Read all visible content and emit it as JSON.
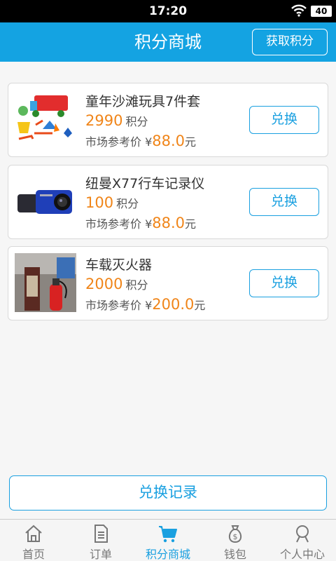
{
  "status_bar": {
    "time": "17:20",
    "battery": "40"
  },
  "header": {
    "title": "积分商城",
    "action_label": "获取积分"
  },
  "products": [
    {
      "name": "童年沙滩玩具7件套",
      "points": "2990",
      "points_unit": "积分",
      "market_label": "市场参考价 ¥",
      "price": "88.0",
      "price_unit": "元",
      "button_label": "兑换"
    },
    {
      "name": "纽曼X77行车记录仪",
      "points": "100",
      "points_unit": "积分",
      "market_label": "市场参考价 ¥",
      "price": "88.0",
      "price_unit": "元",
      "button_label": "兑换"
    },
    {
      "name": "车载灭火器",
      "points": "2000",
      "points_unit": "积分",
      "market_label": "市场参考价 ¥",
      "price": "200.0",
      "price_unit": "元",
      "button_label": "兑换"
    }
  ],
  "record_button": "兑换记录",
  "tabs": [
    {
      "label": "首页",
      "icon": "home-icon"
    },
    {
      "label": "订单",
      "icon": "document-icon"
    },
    {
      "label": "积分商城",
      "icon": "cart-icon",
      "active": true
    },
    {
      "label": "钱包",
      "icon": "money-bag-icon"
    },
    {
      "label": "个人中心",
      "icon": "person-icon"
    }
  ],
  "colors": {
    "accent": "#14a3e2",
    "price": "#f08519"
  }
}
